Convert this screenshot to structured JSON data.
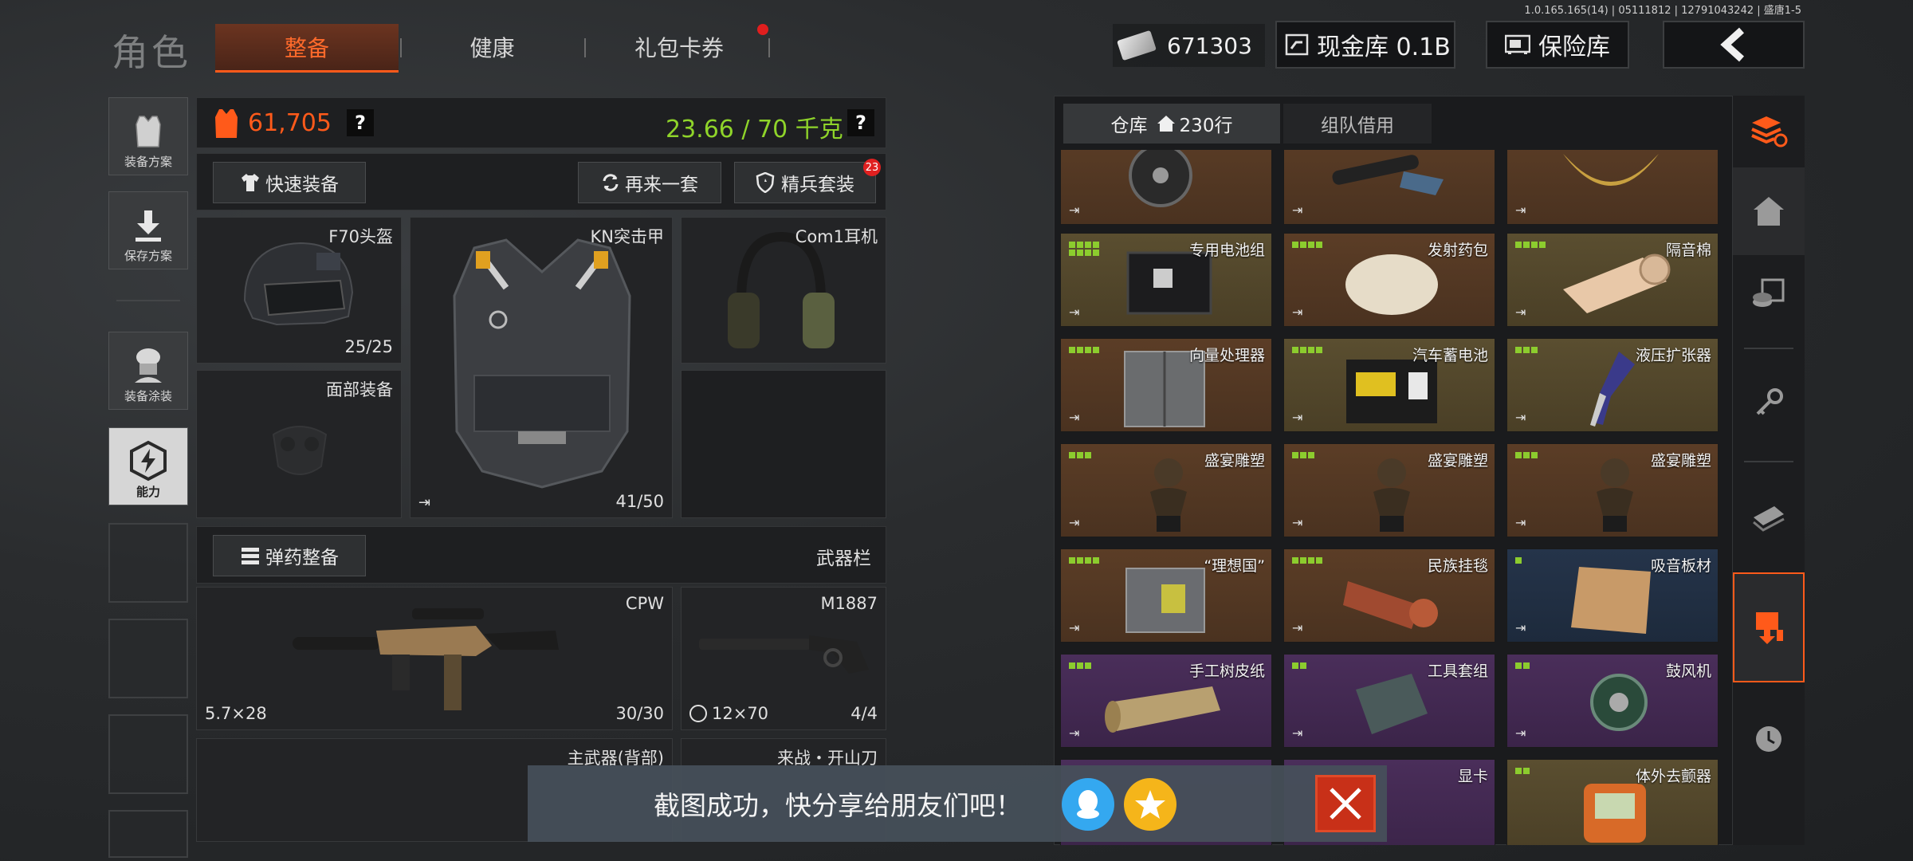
{
  "version": "1.0.165.165(14) | 05111812 | 12791043242 | 盛唐1-5",
  "header": {
    "title": "角色",
    "tabs": [
      {
        "label": "整备",
        "active": true
      },
      {
        "label": "健康",
        "active": false
      },
      {
        "label": "礼包卡券",
        "active": false
      }
    ],
    "money": "671303",
    "cash_vault": "现金库 0.1B",
    "insurance": "保险库"
  },
  "sidebar": {
    "items": [
      {
        "label": "装备方案"
      },
      {
        "label": "保存方案"
      },
      {
        "label": "装备涂装"
      },
      {
        "label": "能力"
      }
    ]
  },
  "loadout": {
    "value": "61,705",
    "weight": "23.66 / 70 千克",
    "quick_equip": "快速装备",
    "reroll": "再来一套",
    "elite_set": "精兵套装",
    "elite_badge": "23",
    "ammo_equip": "弹药整备",
    "weapon_bar": "武器栏",
    "slots": {
      "helmet": {
        "name": "F70头盔",
        "count": "25/25"
      },
      "armor": {
        "name": "KN突击甲",
        "count": "41/50"
      },
      "headset": {
        "name": "Com1耳机"
      },
      "face": {
        "name": "面部装备"
      },
      "primary": {
        "name": "CPW",
        "ammo_type": "5.7×28",
        "count": "30/30"
      },
      "secondary": {
        "name": "M1887",
        "ammo_type": "12×70",
        "count": "4/4"
      },
      "back": {
        "name": "主武器(背部)"
      },
      "melee": {
        "name": "来战・开山刀"
      }
    }
  },
  "storage": {
    "tab_warehouse": "仓库",
    "tab_rows": "230行",
    "tab_team": "组队借用",
    "rows": [
      [
        {
          "name": "",
          "color": "brown"
        },
        {
          "name": "",
          "color": "brown"
        },
        {
          "name": "",
          "color": "brown"
        }
      ],
      [
        {
          "name": "专用电池组",
          "color": "olive"
        },
        {
          "name": "发射药包",
          "color": "brown"
        },
        {
          "name": "隔音棉",
          "color": "olive"
        }
      ],
      [
        {
          "name": "向量处理器",
          "color": "brown"
        },
        {
          "name": "汽车蓄电池",
          "color": "olive"
        },
        {
          "name": "液压扩张器",
          "color": "olive"
        }
      ],
      [
        {
          "name": "盛宴雕塑",
          "color": "brown"
        },
        {
          "name": "盛宴雕塑",
          "color": "brown"
        },
        {
          "name": "盛宴雕塑",
          "color": "brown"
        }
      ],
      [
        {
          "name": "“理想国”",
          "color": "brown"
        },
        {
          "name": "民族挂毯",
          "color": "brown"
        },
        {
          "name": "吸音板材",
          "color": "navy"
        }
      ],
      [
        {
          "name": "手工树皮纸",
          "color": "purple"
        },
        {
          "name": "工具套组",
          "color": "purple"
        },
        {
          "name": "鼓风机",
          "color": "purple"
        }
      ],
      [
        {
          "name": "",
          "color": "purple"
        },
        {
          "name": "显卡",
          "color": "purple"
        },
        {
          "name": "体外去颤器",
          "color": "olive"
        }
      ]
    ]
  },
  "toast": {
    "message": "截图成功，快分享给朋友们吧！"
  }
}
